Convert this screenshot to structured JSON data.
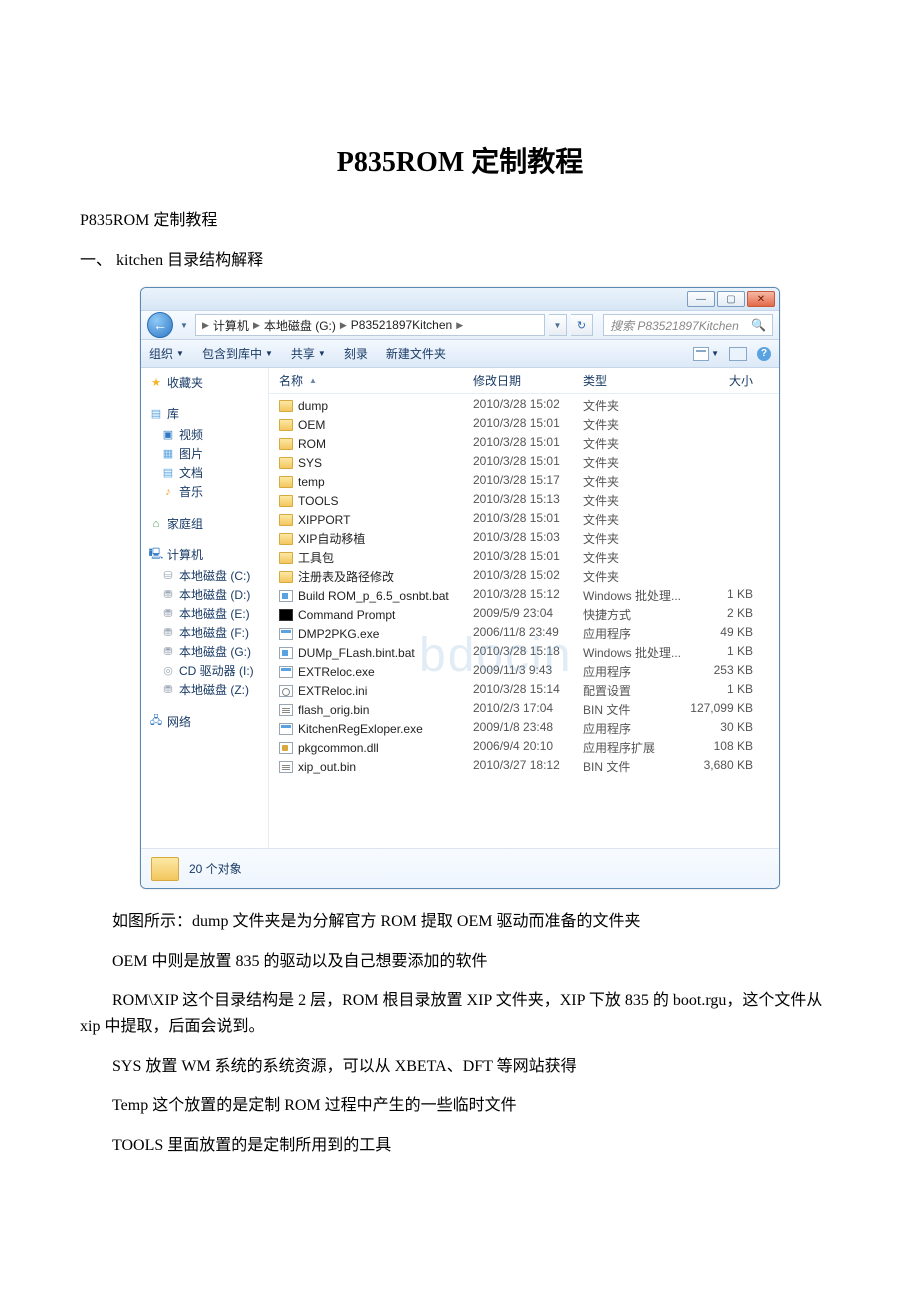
{
  "doc": {
    "title": "P835ROM 定制教程",
    "subtitle": "P835ROM 定制教程",
    "section1": "一、 kitchen 目录结构解释",
    "p_dump": "如图所示：dump 文件夹是为分解官方 ROM 提取 OEM 驱动而准备的文件夹",
    "p_oem": "OEM 中则是放置 835 的驱动以及自己想要添加的软件",
    "p_rom": "ROM\\XIP 这个目录结构是 2 层，ROM 根目录放置 XIP 文件夹，XIP 下放 835 的 boot.rgu，这个文件从 xip 中提取，后面会说到。",
    "p_sys": "SYS 放置 WM 系统的系统资源，可以从 XBETA、DFT 等网站获得",
    "p_temp": "Temp 这个放置的是定制 ROM 过程中产生的一些临时文件",
    "p_tools": "TOOLS 里面放置的是定制所用到的工具"
  },
  "explorer": {
    "breadcrumb": {
      "seg1": "计算机",
      "seg2": "本地磁盘 (G:)",
      "seg3": "P83521897Kitchen"
    },
    "search_placeholder": "搜索 P83521897Kitchen",
    "toolbar": {
      "organize": "组织",
      "include": "包含到库中",
      "share": "共享",
      "burn": "刻录",
      "newfolder": "新建文件夹"
    },
    "nav": {
      "favorites": "收藏夹",
      "libraries": "库",
      "videos": "视频",
      "pictures": "图片",
      "documents": "文档",
      "music": "音乐",
      "homegroup": "家庭组",
      "computer": "计算机",
      "drive_c": "本地磁盘 (C:)",
      "drive_d": "本地磁盘 (D:)",
      "drive_e": "本地磁盘 (E:)",
      "drive_f": "本地磁盘 (F:)",
      "drive_g": "本地磁盘 (G:)",
      "drive_i": "CD 驱动器 (I:)",
      "drive_z": "本地磁盘 (Z:)",
      "network": "网络"
    },
    "cols": {
      "name": "名称",
      "date": "修改日期",
      "type": "类型",
      "size": "大小"
    },
    "rows": [
      {
        "icon": "folder",
        "name": "dump",
        "date": "2010/3/28 15:02",
        "type": "文件夹",
        "size": ""
      },
      {
        "icon": "folder",
        "name": "OEM",
        "date": "2010/3/28 15:01",
        "type": "文件夹",
        "size": ""
      },
      {
        "icon": "folder",
        "name": "ROM",
        "date": "2010/3/28 15:01",
        "type": "文件夹",
        "size": ""
      },
      {
        "icon": "folder",
        "name": "SYS",
        "date": "2010/3/28 15:01",
        "type": "文件夹",
        "size": ""
      },
      {
        "icon": "folder",
        "name": "temp",
        "date": "2010/3/28 15:17",
        "type": "文件夹",
        "size": ""
      },
      {
        "icon": "folder",
        "name": "TOOLS",
        "date": "2010/3/28 15:13",
        "type": "文件夹",
        "size": ""
      },
      {
        "icon": "folder",
        "name": "XIPPORT",
        "date": "2010/3/28 15:01",
        "type": "文件夹",
        "size": ""
      },
      {
        "icon": "folder",
        "name": "XIP自动移植",
        "date": "2010/3/28 15:03",
        "type": "文件夹",
        "size": ""
      },
      {
        "icon": "folder",
        "name": "工具包",
        "date": "2010/3/28 15:01",
        "type": "文件夹",
        "size": ""
      },
      {
        "icon": "folder",
        "name": "注册表及路径修改",
        "date": "2010/3/28 15:02",
        "type": "文件夹",
        "size": ""
      },
      {
        "icon": "bat",
        "name": "Build ROM_p_6.5_osnbt.bat",
        "date": "2010/3/28 15:12",
        "type": "Windows 批处理...",
        "size": "1 KB"
      },
      {
        "icon": "cmd",
        "name": "Command Prompt",
        "date": "2009/5/9 23:04",
        "type": "快捷方式",
        "size": "2 KB"
      },
      {
        "icon": "exe",
        "name": "DMP2PKG.exe",
        "date": "2006/11/8 23:49",
        "type": "应用程序",
        "size": "49 KB"
      },
      {
        "icon": "bat",
        "name": "DUMp_FLash.bint.bat",
        "date": "2010/3/28 15:18",
        "type": "Windows 批处理...",
        "size": "1 KB"
      },
      {
        "icon": "exe",
        "name": "EXTReloc.exe",
        "date": "2009/11/3 9:43",
        "type": "应用程序",
        "size": "253 KB"
      },
      {
        "icon": "ini",
        "name": "EXTReloc.ini",
        "date": "2010/3/28 15:14",
        "type": "配置设置",
        "size": "1 KB"
      },
      {
        "icon": "bin",
        "name": "flash_orig.bin",
        "date": "2010/2/3 17:04",
        "type": "BIN 文件",
        "size": "127,099 KB"
      },
      {
        "icon": "exe",
        "name": "KitchenRegExloper.exe",
        "date": "2009/1/8 23:48",
        "type": "应用程序",
        "size": "30 KB"
      },
      {
        "icon": "dll",
        "name": "pkgcommon.dll",
        "date": "2006/9/4 20:10",
        "type": "应用程序扩展",
        "size": "108 KB"
      },
      {
        "icon": "bin",
        "name": "xip_out.bin",
        "date": "2010/3/27 18:12",
        "type": "BIN 文件",
        "size": "3,680 KB"
      }
    ],
    "status": "20 个对象",
    "watermark": "bdocin"
  }
}
